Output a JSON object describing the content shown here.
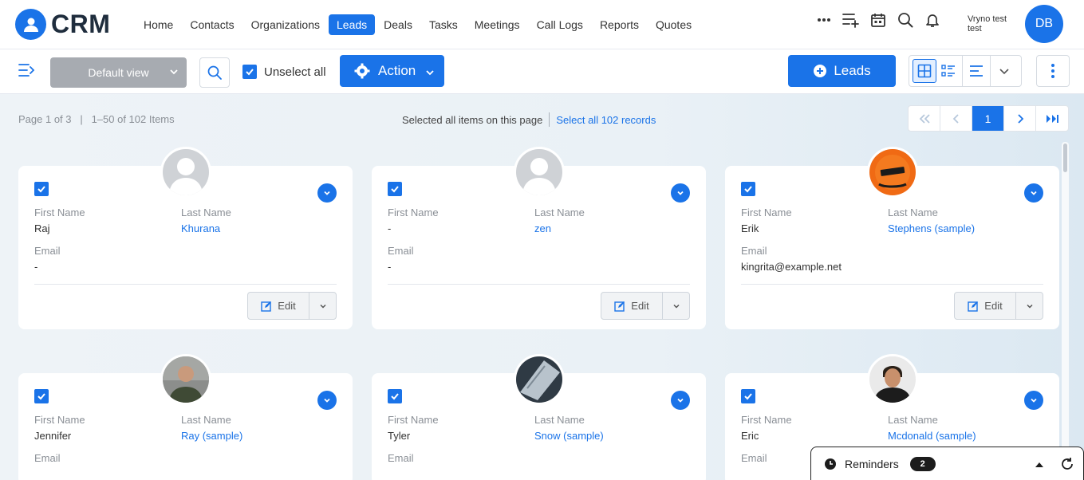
{
  "app": {
    "logo_text": "CRM"
  },
  "nav": {
    "items": [
      {
        "label": "Home",
        "active": false
      },
      {
        "label": "Contacts",
        "active": false
      },
      {
        "label": "Organizations",
        "active": false
      },
      {
        "label": "Leads",
        "active": true
      },
      {
        "label": "Deals",
        "active": false
      },
      {
        "label": "Tasks",
        "active": false
      },
      {
        "label": "Meetings",
        "active": false
      },
      {
        "label": "Call Logs",
        "active": false
      },
      {
        "label": "Reports",
        "active": false
      },
      {
        "label": "Quotes",
        "active": false
      }
    ],
    "icons": [
      "more-icon",
      "add-list-icon",
      "calendar-icon",
      "search-icon",
      "bell-icon"
    ],
    "user_name": "Vryno test test",
    "user_initials": "DB"
  },
  "toolbar": {
    "view_label": "Default view",
    "unselect_label": "Unselect all",
    "unselect_checked": true,
    "action_label": "Action",
    "add_label": "Leads",
    "view_modes": [
      "grid-view-icon",
      "detail-list-icon",
      "list-view-icon"
    ],
    "active_view": "grid-view-icon"
  },
  "listing": {
    "page_info": "Page 1 of 3",
    "range_info": "1–50 of 102 Items",
    "selected_text": "Selected all items on this page",
    "select_all_text": "Select all 102 records",
    "current_page": "1"
  },
  "labels": {
    "first_name": "First Name",
    "last_name": "Last Name",
    "email": "Email",
    "edit": "Edit"
  },
  "cards": [
    {
      "first_name": "Raj",
      "last_name": "Khurana",
      "email": "-",
      "avatar": "placeholder",
      "checked": true
    },
    {
      "first_name": "-",
      "last_name": "zen",
      "email": "-",
      "avatar": "placeholder",
      "checked": true
    },
    {
      "first_name": "Erik",
      "last_name": "Stephens (sample)",
      "email": "kingrita@example.net",
      "avatar": "orange-photo",
      "checked": true
    },
    {
      "first_name": "Jennifer",
      "last_name": "Ray (sample)",
      "email": "",
      "avatar": "man-photo",
      "checked": true
    },
    {
      "first_name": "Tyler",
      "last_name": "Snow (sample)",
      "email": "",
      "avatar": "card-photo",
      "checked": true
    },
    {
      "first_name": "Eric",
      "last_name": "Mcdonald (sample)",
      "email": "",
      "avatar": "portrait-photo",
      "checked": true
    }
  ],
  "reminders": {
    "label": "Reminders",
    "count": "2"
  },
  "colors": {
    "primary": "#1a73e8",
    "disabled": "#a7abb1",
    "background": "#eef3f7"
  }
}
